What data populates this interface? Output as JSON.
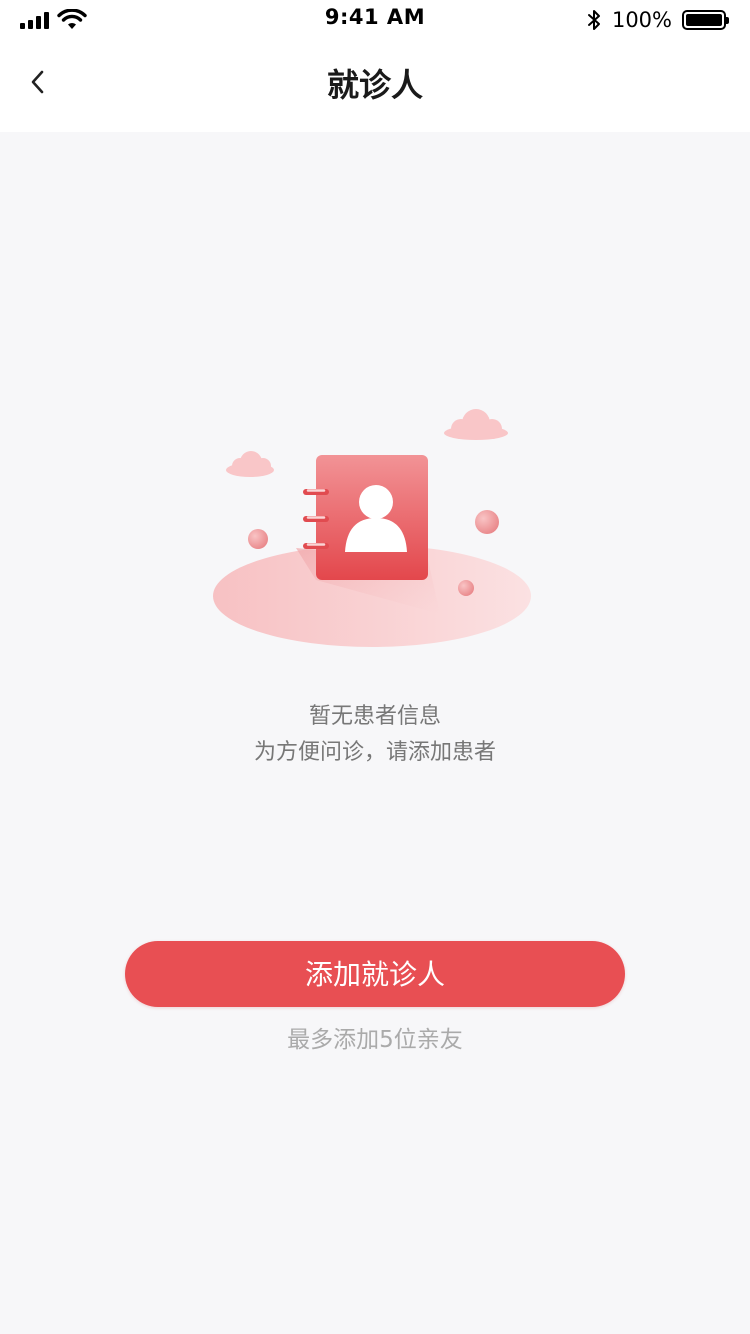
{
  "status_bar": {
    "time": "9:41 AM",
    "battery": "100%",
    "icons": [
      "signal-icon",
      "wifi-icon",
      "bluetooth-icon",
      "battery-icon"
    ]
  },
  "nav": {
    "title": "就诊人",
    "back_icon": "chevron-left-icon"
  },
  "empty_state": {
    "illustration_icon": "contact-book-icon",
    "line1": "暂无患者信息",
    "line2": "为方便问诊，请添加患者"
  },
  "actions": {
    "add_label": "添加就诊人",
    "limit_text": "最多添加5位亲友"
  },
  "colors": {
    "accent": "#e84f53",
    "background": "#f7f7f9",
    "secondary_text": "#777777",
    "hint_text": "#aaaaaa"
  }
}
